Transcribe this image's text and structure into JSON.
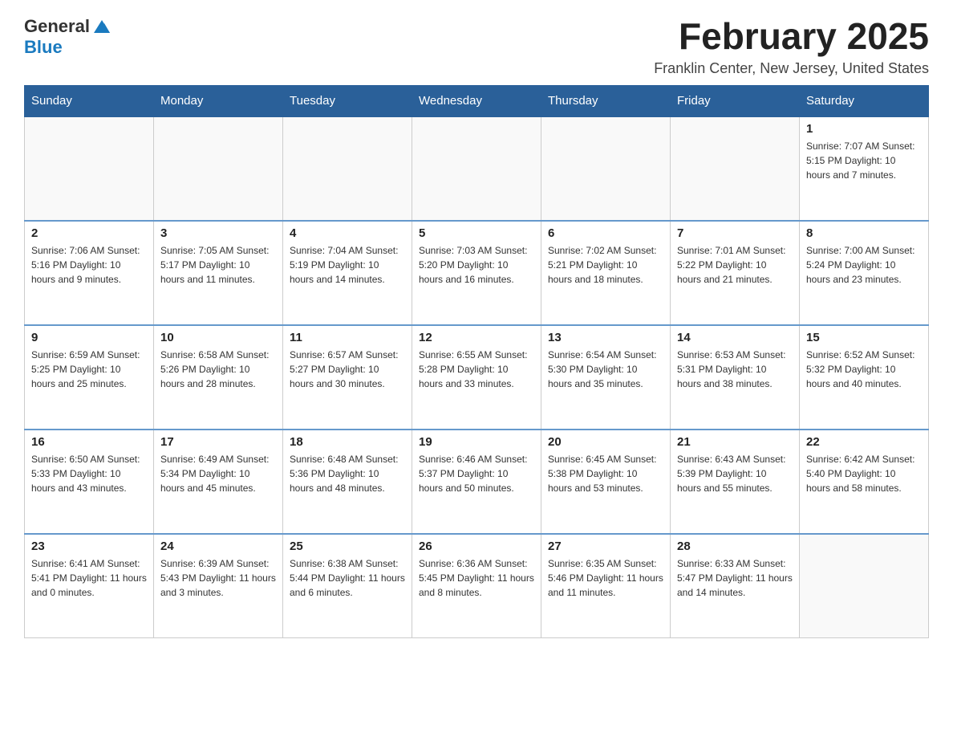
{
  "header": {
    "logo_general": "General",
    "logo_blue": "Blue",
    "month_title": "February 2025",
    "location": "Franklin Center, New Jersey, United States"
  },
  "weekdays": [
    "Sunday",
    "Monday",
    "Tuesday",
    "Wednesday",
    "Thursday",
    "Friday",
    "Saturday"
  ],
  "weeks": [
    [
      {
        "day": "",
        "info": ""
      },
      {
        "day": "",
        "info": ""
      },
      {
        "day": "",
        "info": ""
      },
      {
        "day": "",
        "info": ""
      },
      {
        "day": "",
        "info": ""
      },
      {
        "day": "",
        "info": ""
      },
      {
        "day": "1",
        "info": "Sunrise: 7:07 AM\nSunset: 5:15 PM\nDaylight: 10 hours and 7 minutes."
      }
    ],
    [
      {
        "day": "2",
        "info": "Sunrise: 7:06 AM\nSunset: 5:16 PM\nDaylight: 10 hours and 9 minutes."
      },
      {
        "day": "3",
        "info": "Sunrise: 7:05 AM\nSunset: 5:17 PM\nDaylight: 10 hours and 11 minutes."
      },
      {
        "day": "4",
        "info": "Sunrise: 7:04 AM\nSunset: 5:19 PM\nDaylight: 10 hours and 14 minutes."
      },
      {
        "day": "5",
        "info": "Sunrise: 7:03 AM\nSunset: 5:20 PM\nDaylight: 10 hours and 16 minutes."
      },
      {
        "day": "6",
        "info": "Sunrise: 7:02 AM\nSunset: 5:21 PM\nDaylight: 10 hours and 18 minutes."
      },
      {
        "day": "7",
        "info": "Sunrise: 7:01 AM\nSunset: 5:22 PM\nDaylight: 10 hours and 21 minutes."
      },
      {
        "day": "8",
        "info": "Sunrise: 7:00 AM\nSunset: 5:24 PM\nDaylight: 10 hours and 23 minutes."
      }
    ],
    [
      {
        "day": "9",
        "info": "Sunrise: 6:59 AM\nSunset: 5:25 PM\nDaylight: 10 hours and 25 minutes."
      },
      {
        "day": "10",
        "info": "Sunrise: 6:58 AM\nSunset: 5:26 PM\nDaylight: 10 hours and 28 minutes."
      },
      {
        "day": "11",
        "info": "Sunrise: 6:57 AM\nSunset: 5:27 PM\nDaylight: 10 hours and 30 minutes."
      },
      {
        "day": "12",
        "info": "Sunrise: 6:55 AM\nSunset: 5:28 PM\nDaylight: 10 hours and 33 minutes."
      },
      {
        "day": "13",
        "info": "Sunrise: 6:54 AM\nSunset: 5:30 PM\nDaylight: 10 hours and 35 minutes."
      },
      {
        "day": "14",
        "info": "Sunrise: 6:53 AM\nSunset: 5:31 PM\nDaylight: 10 hours and 38 minutes."
      },
      {
        "day": "15",
        "info": "Sunrise: 6:52 AM\nSunset: 5:32 PM\nDaylight: 10 hours and 40 minutes."
      }
    ],
    [
      {
        "day": "16",
        "info": "Sunrise: 6:50 AM\nSunset: 5:33 PM\nDaylight: 10 hours and 43 minutes."
      },
      {
        "day": "17",
        "info": "Sunrise: 6:49 AM\nSunset: 5:34 PM\nDaylight: 10 hours and 45 minutes."
      },
      {
        "day": "18",
        "info": "Sunrise: 6:48 AM\nSunset: 5:36 PM\nDaylight: 10 hours and 48 minutes."
      },
      {
        "day": "19",
        "info": "Sunrise: 6:46 AM\nSunset: 5:37 PM\nDaylight: 10 hours and 50 minutes."
      },
      {
        "day": "20",
        "info": "Sunrise: 6:45 AM\nSunset: 5:38 PM\nDaylight: 10 hours and 53 minutes."
      },
      {
        "day": "21",
        "info": "Sunrise: 6:43 AM\nSunset: 5:39 PM\nDaylight: 10 hours and 55 minutes."
      },
      {
        "day": "22",
        "info": "Sunrise: 6:42 AM\nSunset: 5:40 PM\nDaylight: 10 hours and 58 minutes."
      }
    ],
    [
      {
        "day": "23",
        "info": "Sunrise: 6:41 AM\nSunset: 5:41 PM\nDaylight: 11 hours and 0 minutes."
      },
      {
        "day": "24",
        "info": "Sunrise: 6:39 AM\nSunset: 5:43 PM\nDaylight: 11 hours and 3 minutes."
      },
      {
        "day": "25",
        "info": "Sunrise: 6:38 AM\nSunset: 5:44 PM\nDaylight: 11 hours and 6 minutes."
      },
      {
        "day": "26",
        "info": "Sunrise: 6:36 AM\nSunset: 5:45 PM\nDaylight: 11 hours and 8 minutes."
      },
      {
        "day": "27",
        "info": "Sunrise: 6:35 AM\nSunset: 5:46 PM\nDaylight: 11 hours and 11 minutes."
      },
      {
        "day": "28",
        "info": "Sunrise: 6:33 AM\nSunset: 5:47 PM\nDaylight: 11 hours and 14 minutes."
      },
      {
        "day": "",
        "info": ""
      }
    ]
  ]
}
